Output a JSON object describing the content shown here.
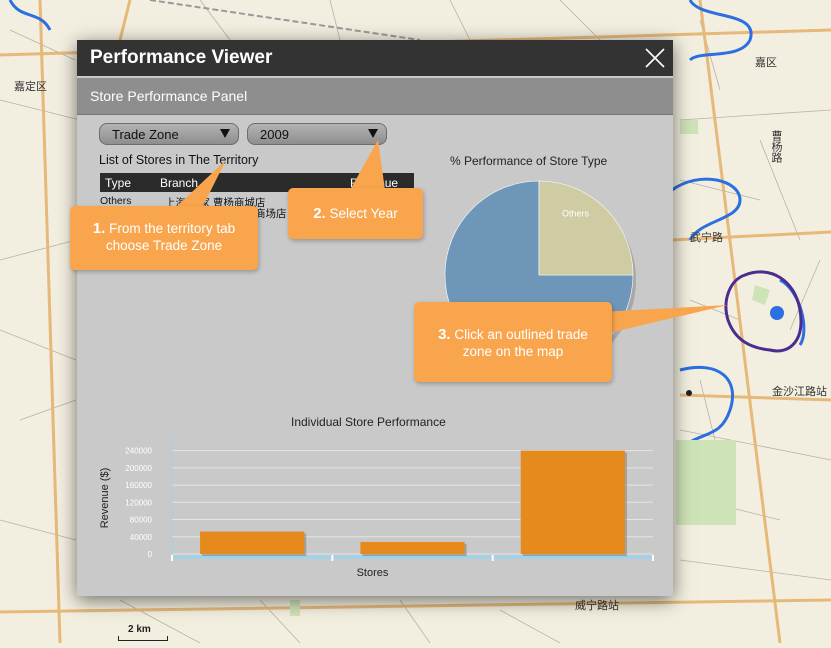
{
  "map": {
    "labels": [
      "嘉定区",
      "嘉区",
      "曹杨路",
      "武宁路",
      "金沙江路站",
      "威宁路站"
    ],
    "scale_label": "2 km"
  },
  "dialog": {
    "title": "Performance Viewer",
    "panel_title": "Store Performance Panel",
    "territory_select": "Trade Zone",
    "year_select": "2009",
    "list_caption": "List of Stores in The Territory",
    "table_headers": [
      "Type",
      "Branch",
      "Revenue"
    ],
    "table_rows": [
      {
        "type": "Others",
        "branch_line1": "上海 曹家 曹杨商城店",
        "branch_line2": "商场店"
      }
    ]
  },
  "callouts": {
    "step1_num": "1.",
    "step1_text": "From the territory tab choose Trade Zone",
    "step2_num": "2.",
    "step2_text": "Select Year",
    "step3_num": "3.",
    "step3_text": "Click an outlined trade zone on the map"
  },
  "colors": {
    "bar": "#e68a1e",
    "pie_main": "#6d96b8",
    "pie_others": "#cfcba2",
    "callout": "#f9a54d",
    "zone_outline": "#4a2d8f",
    "water": "#2b6fe0"
  },
  "chart_data": [
    {
      "type": "pie",
      "title": "% Performance of Store Type",
      "slices": [
        {
          "label": "",
          "value": 75
        },
        {
          "label": "Others",
          "value": 25
        }
      ]
    },
    {
      "type": "bar",
      "title": "Individual Store Performance",
      "xlabel": "Stores",
      "ylabel": "Revenue ($)",
      "categories": [
        "",
        "",
        ""
      ],
      "values": [
        52000,
        28000,
        240000
      ],
      "ylim": [
        0,
        260000
      ],
      "yticks": [
        "0",
        "40000",
        "80000",
        "120000",
        "160000",
        "200000",
        "240000"
      ],
      "grid": true
    }
  ]
}
